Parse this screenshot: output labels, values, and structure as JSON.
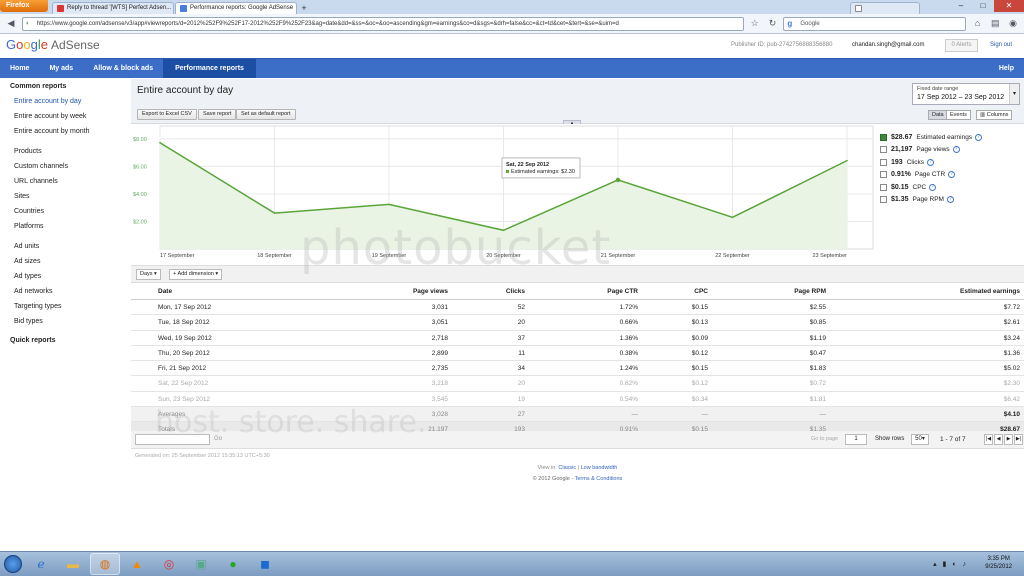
{
  "browser": {
    "menu_label": "Firefox",
    "tabs": [
      {
        "label": "Reply to thread '[WTS] Perfect Adsen...",
        "active": false
      },
      {
        "label": "Performance reports: Google AdSense",
        "active": true
      },
      {
        "label": "",
        "active": false
      }
    ],
    "url": "https://www.google.com/adsense/v3/app#viewreports/d=2012%252F9%252F17-2012%252F9%252F23&ag=date&dd=&ss=&oc=&oo=ascending&gm=earnings&co=d&sgs=&drh=false&cc=&ct=td&cet=&tert=&se=&uim=d",
    "search_placeholder": "Google"
  },
  "header": {
    "logo_letters": [
      "G",
      "o",
      "o",
      "g",
      "l",
      "e"
    ],
    "product": "AdSense",
    "publisher_id": "Publisher ID: pub-2742756888356880",
    "email": "chandan.singh@gmail.com",
    "alerts": "0 Alerts",
    "signout": "Sign out"
  },
  "nav": {
    "items": [
      "Home",
      "My ads",
      "Allow & block ads",
      "Performance reports"
    ],
    "help": "Help"
  },
  "sidebar": {
    "common_heading": "Common reports",
    "common": [
      "Entire account by day",
      "Entire account by week",
      "Entire account by month"
    ],
    "group2": [
      "Products",
      "Custom channels",
      "URL channels",
      "Sites",
      "Countries",
      "Platforms"
    ],
    "group3": [
      "Ad units",
      "Ad sizes",
      "Ad types",
      "Ad networks",
      "Targeting types",
      "Bid types"
    ],
    "quick_heading": "Quick reports"
  },
  "report": {
    "title": "Entire account by day",
    "buttons": [
      "Export to Excel CSV",
      "Save report",
      "Set as default report"
    ],
    "date_label": "Fixed date range",
    "date_value": "17 Sep 2012 – 23 Sep 2012",
    "view_buttons": [
      "Data",
      "Events",
      "Columns"
    ],
    "dim_button": "Days",
    "add_dim": "Add dimension"
  },
  "chart_data": {
    "type": "line",
    "x": [
      "17 September",
      "18 September",
      "19 September",
      "20 September",
      "21 September",
      "22 September",
      "23 September"
    ],
    "series": [
      {
        "name": "Estimated earnings",
        "values": [
          7.72,
          2.61,
          3.24,
          1.36,
          5.02,
          2.3,
          6.42
        ]
      }
    ],
    "y_ticks": [
      "$8.00",
      "$6.00",
      "$4.00",
      "$2.00"
    ],
    "ylim": [
      0,
      8.5
    ],
    "grid": true,
    "tooltip": {
      "title": "Sat, 22 Sep 2012",
      "text": "Estimated earnings: $2.30",
      "index": 4
    },
    "line_color": "#5aa53a",
    "fill_color": "#eaf4e4"
  },
  "legend": [
    {
      "value": "$28.67",
      "label": "Estimated earnings",
      "checked": true
    },
    {
      "value": "21,197",
      "label": "Page views",
      "checked": false
    },
    {
      "value": "193",
      "label": "Clicks",
      "checked": false
    },
    {
      "value": "0.91%",
      "label": "Page CTR",
      "checked": false
    },
    {
      "value": "$0.15",
      "label": "CPC",
      "checked": false
    },
    {
      "value": "$1.35",
      "label": "Page RPM",
      "checked": false
    }
  ],
  "table": {
    "headers": [
      "Date",
      "Page views",
      "Clicks",
      "Page CTR",
      "CPC",
      "Page RPM",
      "Estimated earnings"
    ],
    "rows": [
      [
        "Mon, 17 Sep 2012",
        "3,031",
        "52",
        "1.72%",
        "$0.15",
        "$2.55",
        "$7.72"
      ],
      [
        "Tue, 18 Sep 2012",
        "3,051",
        "20",
        "0.66%",
        "$0.13",
        "$0.85",
        "$2.61"
      ],
      [
        "Wed, 19 Sep 2012",
        "2,718",
        "37",
        "1.36%",
        "$0.09",
        "$1.19",
        "$3.24"
      ],
      [
        "Thu, 20 Sep 2012",
        "2,899",
        "11",
        "0.38%",
        "$0.12",
        "$0.47",
        "$1.36"
      ],
      [
        "Fri, 21 Sep 2012",
        "2,735",
        "34",
        "1.24%",
        "$0.15",
        "$1.83",
        "$5.02"
      ],
      [
        "Sat, 22 Sep 2012",
        "3,218",
        "20",
        "0.62%",
        "$0.12",
        "$0.72",
        "$2.30"
      ],
      [
        "Sun, 23 Sep 2012",
        "3,545",
        "19",
        "0.54%",
        "$0.34",
        "$1.81",
        "$6.42"
      ]
    ],
    "averages": [
      "Averages",
      "3,028",
      "27",
      "—",
      "—",
      "—",
      "$4.10"
    ],
    "totals": [
      "Totals",
      "21,197",
      "193",
      "0.91%",
      "$0.15",
      "$1.35",
      "$28.67"
    ]
  },
  "pager": {
    "go": "Go",
    "go_to_page": "Go to page",
    "page": "1",
    "show_rows": "Show rows",
    "rows": "50",
    "range": "1 - 7 of 7"
  },
  "footer": {
    "generated": "Generated on: 25 September 2012 15:35:13 UTC+5:30",
    "view_in": "View in:",
    "classic": "Classic",
    "low_bandwidth": "Low bandwidth",
    "copyright": "© 2012 Google",
    "terms": "Terms & Conditions"
  },
  "watermark": {
    "line1": "photobucket",
    "line2": "host. store. share."
  },
  "taskbar": {
    "time": "3:35 PM",
    "date": "9/25/2012"
  }
}
